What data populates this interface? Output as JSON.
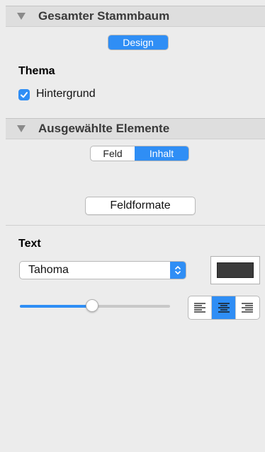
{
  "section1": {
    "title": "Gesamter Stammbaum",
    "tabs": [
      {
        "label": "Design",
        "active": true
      }
    ]
  },
  "theme": {
    "heading": "Thema",
    "background_checkbox": {
      "label": "Hintergrund",
      "checked": true
    }
  },
  "section2": {
    "title": "Ausgewählte Elemente",
    "tabs": [
      {
        "label": "Feld",
        "active": false
      },
      {
        "label": "Inhalt",
        "active": true
      }
    ],
    "field_formats_button": "Feldformate"
  },
  "text": {
    "heading": "Text",
    "font_select": {
      "value": "Tahoma"
    },
    "color": "#3b3b3b",
    "size_slider_level": 0.48,
    "alignment": {
      "options": [
        "left",
        "center",
        "right"
      ],
      "selected": "center"
    }
  },
  "colors": {
    "accent": "#2f8ef5",
    "panel_bg": "#ececec"
  }
}
